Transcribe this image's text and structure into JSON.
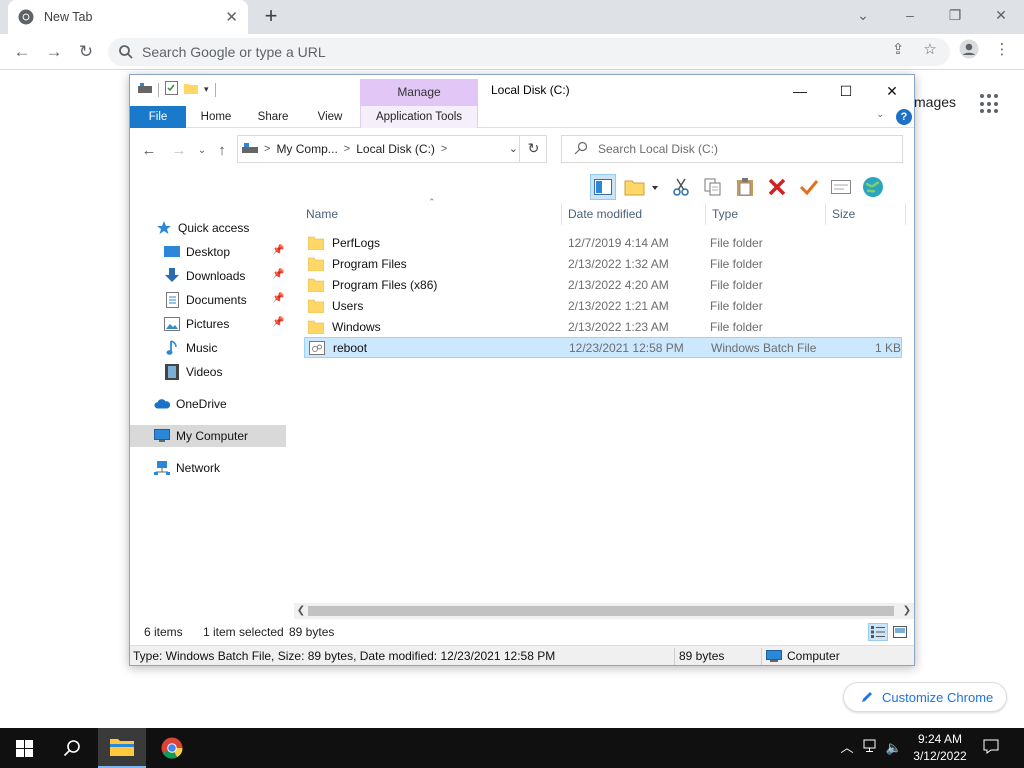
{
  "chrome": {
    "tab_title": "New Tab",
    "tab_close": "✕",
    "new_tab": "+",
    "omnibox_placeholder": "Search Google or type a URL",
    "ntp_images": "mages",
    "customize_label": "Customize Chrome",
    "win_min": "–",
    "win_restore": "❐",
    "win_close": "✕",
    "win_tabsearch": "⌄"
  },
  "explorer": {
    "manage_label": "Manage",
    "title": "Local Disk (C:)",
    "ribbon_tabs": [
      "File",
      "Home",
      "Share",
      "View",
      "Application Tools"
    ],
    "help": "?",
    "breadcrumb": [
      "My Comp...",
      "Local Disk (C:)"
    ],
    "search_placeholder": "Search Local Disk (C:)",
    "nav": {
      "quick_access": "Quick access",
      "desktop": "Desktop",
      "downloads": "Downloads",
      "documents": "Documents",
      "pictures": "Pictures",
      "music": "Music",
      "videos": "Videos",
      "onedrive": "OneDrive",
      "my_computer": "My Computer",
      "network": "Network"
    },
    "columns": {
      "name": "Name",
      "date": "Date modified",
      "type": "Type",
      "size": "Size"
    },
    "files": [
      {
        "name": "PerfLogs",
        "date": "12/7/2019 4:14 AM",
        "type": "File folder",
        "size": ""
      },
      {
        "name": "Program Files",
        "date": "2/13/2022 1:32 AM",
        "type": "File folder",
        "size": ""
      },
      {
        "name": "Program Files (x86)",
        "date": "2/13/2022 4:20 AM",
        "type": "File folder",
        "size": ""
      },
      {
        "name": "Users",
        "date": "2/13/2022 1:21 AM",
        "type": "File folder",
        "size": ""
      },
      {
        "name": "Windows",
        "date": "2/13/2022 1:23 AM",
        "type": "File folder",
        "size": ""
      },
      {
        "name": "reboot",
        "date": "12/23/2021 12:58 PM",
        "type": "Windows Batch File",
        "size": "1 KB"
      }
    ],
    "status": {
      "items": "6 items",
      "selected": "1 item selected",
      "bytes": "89 bytes"
    },
    "details": {
      "info": "Type: Windows Batch File, Size: 89 bytes, Date modified: 12/23/2021 12:58 PM",
      "size": "89 bytes",
      "location": "Computer"
    }
  },
  "taskbar": {
    "time": "9:24 AM",
    "date": "3/12/2022"
  },
  "colors": {
    "file_tab": "#1979ca",
    "manage": "#e2c6f5",
    "selection": "#cce8ff",
    "folder": "#ffd766",
    "chrome_accent": "#1a73e8"
  }
}
